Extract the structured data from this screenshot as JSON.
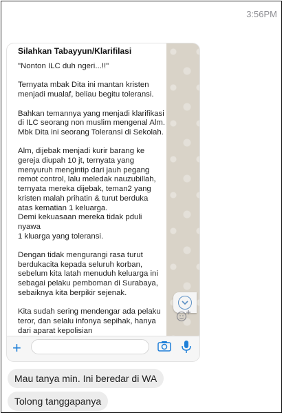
{
  "chat": {
    "time": "3:56PM",
    "messages": [
      {
        "text": "Mau tanya min. Ini beredar di WA"
      },
      {
        "text": "Tolong tanggapanya"
      }
    ]
  },
  "attachment": {
    "title": "Silahkan Tabayyun/Klarifilasi",
    "body": "\"Nonton ILC duh ngeri...!!\"\n\nTernyata mbak Dita ini mantan kristen\nmenjadi mualaf, beliau begitu toleransi.\n\nBahkan temannya yang menjadi klarifikasi\ndi ILC seorang non muslim mengenal Alm.\nMbk Dita ini seorang Toleransi di Sekolah.\n\nAlm, dijebak menjadi kurir barang ke\ngereja diupah 10 jt, ternyata yang\nmenyuruh mengintip dari jauh pegang\nremot control, lalu meledak nauzubillah,\nternyata mereka dijebak, teman2 yang\nkristen malah prihatin & turut berduka\natas kematian 1 keluarga.\nDemi kekuasaan mereka tidak pduli nyawa\n1 kluarga yang toleransi.\n\nDengan tidak mengurangi rasa turut\nberdukacita kepada seluruh korban,\nsebelum kita latah menuduh keluarga ini\nsebagai pelaku pemboman di Surabaya,\nsebaiknya kita berpikir sejenak.\n\nKita sudah sering mendengar ada pelaku\nteror, dan selalu infonya sepihak, hanya\ndari aparat kepolisian",
    "icons": {
      "add": "plus-icon",
      "camera": "camera-icon",
      "mic": "microphone-icon",
      "scroll": "chevron-down-icon",
      "emoji": "emoji-add-icon"
    },
    "accent_color": "#1e7fd8"
  }
}
